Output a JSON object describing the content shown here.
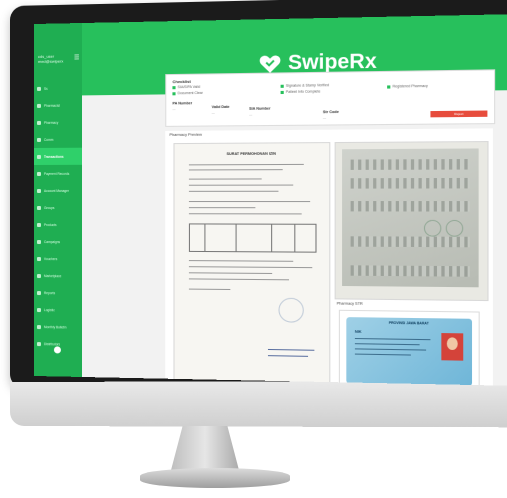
{
  "app": {
    "brand": "SwipeRx",
    "accent": "#27c05c"
  },
  "sidebar": {
    "user_line": "cds_user",
    "email_line": "med@swiperx",
    "menu_icon": "menu-icon",
    "items": [
      {
        "label": "Ss",
        "icon": "dot-icon"
      },
      {
        "label": "Pharmacist",
        "icon": "dot-icon"
      },
      {
        "label": "Pharmacy",
        "icon": "dot-icon"
      },
      {
        "label": "Comm",
        "icon": "dot-icon"
      },
      {
        "label": "Transactions",
        "icon": "dot-icon",
        "active": true
      },
      {
        "label": "Payment Records",
        "icon": "dot-icon"
      },
      {
        "label": "Account Manager",
        "icon": "dot-icon"
      },
      {
        "label": "Groups",
        "icon": "dot-icon"
      },
      {
        "label": "Products",
        "icon": "dot-icon"
      },
      {
        "label": "Campaigns",
        "icon": "dot-icon"
      },
      {
        "label": "Vouchers",
        "icon": "dot-icon"
      },
      {
        "label": "Marketplace",
        "icon": "dot-icon"
      },
      {
        "label": "Reports",
        "icon": "dot-icon"
      },
      {
        "label": "Logistic",
        "icon": "dot-icon"
      },
      {
        "label": "Monthly Bulletin",
        "icon": "dot-icon"
      },
      {
        "label": "Distributors",
        "icon": "dot-icon"
      },
      {
        "label": "Logout",
        "icon": "dot-icon"
      },
      {
        "label": "Settings",
        "icon": "dot-icon"
      }
    ]
  },
  "info": {
    "title": "Checklist",
    "checks": [
      "SIA/SIPA Valid",
      "Document Clear",
      "Signature & Stamp Verified",
      "Patient Info Complete",
      "Registered Pharmacy"
    ],
    "fields": [
      {
        "label": "PA Number",
        "value": "—"
      },
      {
        "label": "Valid Date",
        "value": "—"
      },
      {
        "label": "SIA Number",
        "value": "—"
      },
      {
        "label": "Str Code",
        "value": "—"
      }
    ],
    "reject_label": "Reject"
  },
  "content": {
    "preview_label": "Pharmacy Preview",
    "doc_header": "SURAT PERMOHONAN IZIN",
    "right_label": "Pharmacy STR",
    "ktp_title": "PROVINSI JAWA BARAT",
    "ktp_nik": "NIK"
  }
}
